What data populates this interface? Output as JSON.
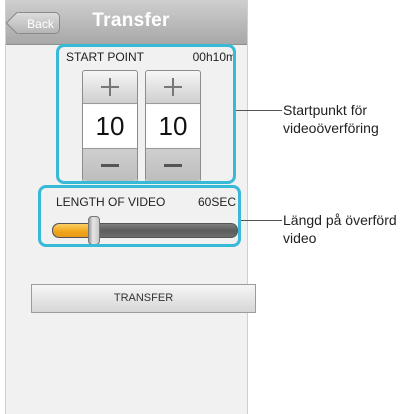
{
  "header": {
    "back_label": "Back",
    "title": "Transfer"
  },
  "start_point": {
    "label": "START POINT",
    "value": "00h10m",
    "stepper_left": {
      "value": "10"
    },
    "stepper_right": {
      "value": "10"
    }
  },
  "video_length": {
    "label": "LENGTH OF VIDEO",
    "value": "60SEC",
    "slider_level": 0.22
  },
  "transfer_button": {
    "label": "TRANSFER"
  },
  "annotations": {
    "start_point_caption": [
      "Startpunkt för",
      "videoöverföring"
    ],
    "length_caption": [
      "Längd på överförd",
      "video"
    ]
  },
  "colors": {
    "highlight": "#37b9d8",
    "slider_fill": "#f0a418",
    "titlebar": "#b9b9b9"
  }
}
